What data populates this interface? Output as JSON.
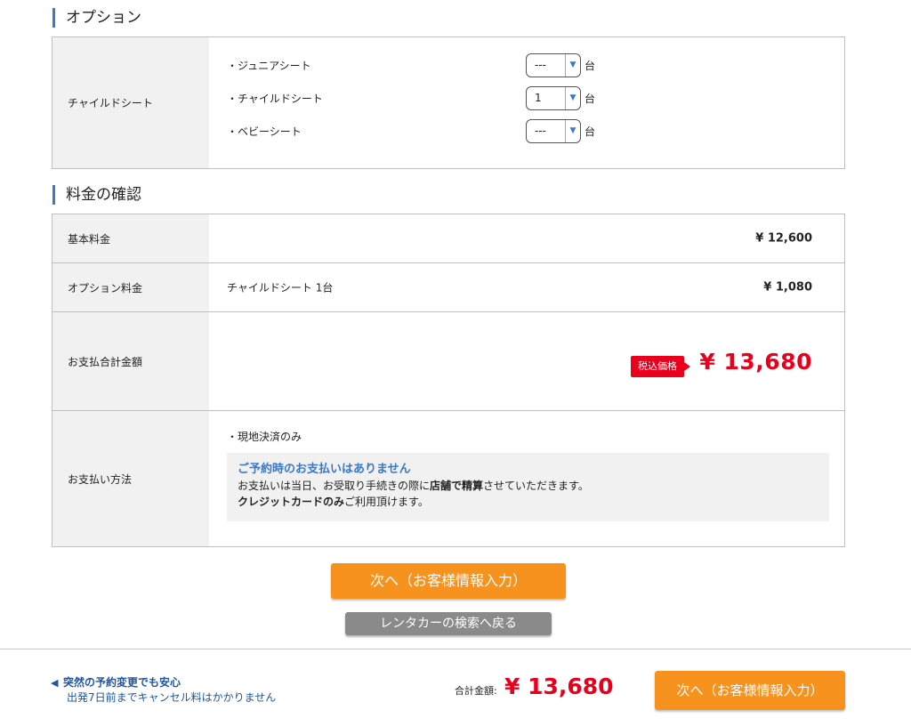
{
  "options": {
    "section_title": "オプション",
    "row_label": "チャイルドシート",
    "seats": [
      {
        "name": "・ジュニアシート",
        "value": "---",
        "unit": "台"
      },
      {
        "name": "・チャイルドシート",
        "value": "1",
        "unit": "台"
      },
      {
        "name": "・ベビーシート",
        "value": "---",
        "unit": "台"
      }
    ]
  },
  "price": {
    "section_title": "料金の確認",
    "base_label": "基本料金",
    "base_amount": "¥ 12,600",
    "option_label": "オプション料金",
    "option_desc": "チャイルドシート 1台",
    "option_amount": "¥ 1,080",
    "total_label": "お支払合計金額",
    "tax_badge": "税込価格",
    "total_amount": "¥ 13,680",
    "pay_method_label": "お支払い方法",
    "pay_note": "・現地決済のみ",
    "pay_head": "ご予約時のお支払いはありません",
    "pay_line1_a": "お支払いは当日、お受取り手続きの際に",
    "pay_line1_b": "店舗で精算",
    "pay_line1_c": "させていただきます。",
    "pay_line2_a": "クレジットカードのみ",
    "pay_line2_b": "ご利用頂けます。"
  },
  "buttons": {
    "next_main": "次へ（お客様情報入力）",
    "back": "レンタカーの検索へ戻る"
  },
  "footer": {
    "msg_title": "突然の予約変更でも安心",
    "msg_sub": "出発7日前までキャンセル料はかかりません",
    "total_label": "合計金額:",
    "total_amount": "¥ 13,680",
    "next_button": "次へ（お客様情報入力）",
    "icon": "megaphone-icon"
  },
  "colors": {
    "accent_blue": "#3a78c8",
    "price_red": "#e8001c",
    "button_orange": "#f7921e",
    "button_gray": "#8a8a8a"
  }
}
